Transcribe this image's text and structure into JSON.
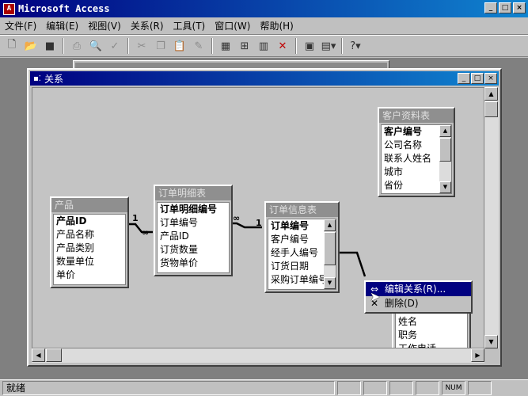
{
  "app": {
    "title": "Microsoft Access"
  },
  "window_buttons": {
    "minimize": "_",
    "maximize": "□",
    "close": "×"
  },
  "menu": [
    "文件(F)",
    "编辑(E)",
    "视图(V)",
    "关系(R)",
    "工具(T)",
    "窗口(W)",
    "帮助(H)"
  ],
  "toolbar_icons": [
    "new-icon",
    "open-icon",
    "save-icon",
    "print-icon",
    "print-preview-icon",
    "spell-check-icon",
    "cut-icon",
    "copy-icon",
    "paste-icon",
    "format-painter-icon",
    "show-table-icon",
    "show-direct-icon",
    "show-all-icon",
    "delete-icon",
    "new-object-icon",
    "properties-icon",
    "help-icon"
  ],
  "relationships_window": {
    "title": "关系"
  },
  "tables": {
    "products": {
      "title": "产品",
      "fields": [
        "产品ID",
        "产品名称",
        "产品类别",
        "数量单位",
        "单价"
      ]
    },
    "order_details": {
      "title": "订单明细表",
      "fields": [
        "订单明细编号",
        "订单编号",
        "产品ID",
        "订货数量",
        "货物单价"
      ]
    },
    "orders": {
      "title": "订单信息表",
      "fields": [
        "订单编号",
        "客户编号",
        "经手人编号",
        "订货日期",
        "采购订单编号"
      ]
    },
    "customers": {
      "title": "客户资料表",
      "fields": [
        "客户编号",
        "公司名称",
        "联系人姓名",
        "城市",
        "省份"
      ]
    },
    "employees": {
      "title": "",
      "fields": [
        "姓名",
        "职务",
        "工作电话"
      ]
    }
  },
  "relation_labels": {
    "one": "1",
    "many": "∞"
  },
  "context_menu": [
    {
      "label": "编辑关系(R)...",
      "icon": "relationship-icon"
    },
    {
      "label": "删除(D)",
      "icon": "delete-x-icon"
    }
  ],
  "status_bar": {
    "text": "就绪",
    "num": "NUM"
  }
}
